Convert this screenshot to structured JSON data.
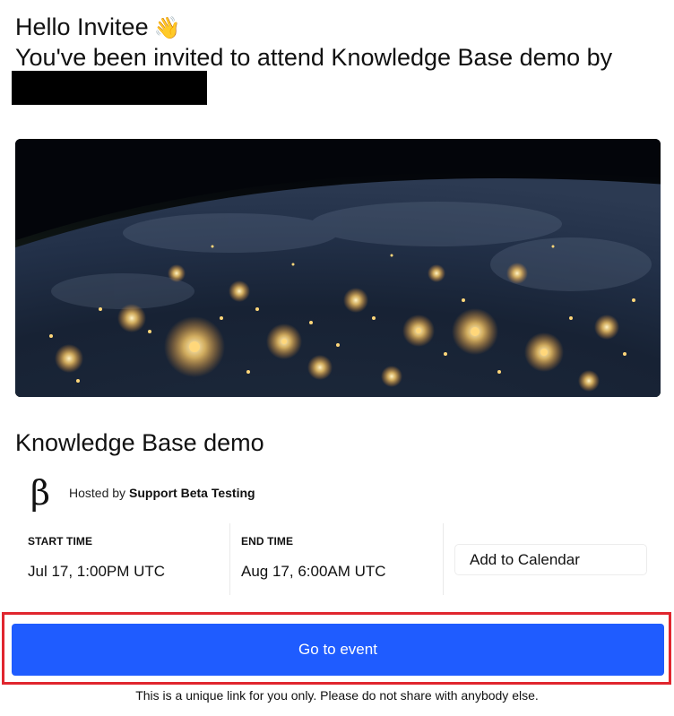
{
  "greeting": {
    "hello": "Hello Invitee",
    "wave_emoji": "👋",
    "invite_text": "You've been invited to attend Knowledge Base demo by"
  },
  "hero_image": {
    "icon": "earth-at-night-image"
  },
  "event": {
    "title": "Knowledge Base demo",
    "host_prefix": "Hosted by",
    "host_name": "Support Beta Testing",
    "host_logo": "β"
  },
  "times": {
    "start_label": "START TIME",
    "start_value": "Jul 17, 1:00PM UTC",
    "end_label": "END TIME",
    "end_value": "Aug 17, 6:00AM UTC"
  },
  "actions": {
    "add_to_calendar": "Add to Calendar",
    "go_to_event": "Go to event"
  },
  "footnote": "This is a unique link for you only. Please do not share with anybody else.",
  "colors": {
    "primary_button": "#1f5cff",
    "highlight_border": "#e0262e",
    "redaction": "#000000"
  }
}
